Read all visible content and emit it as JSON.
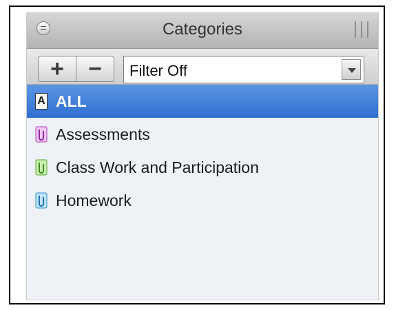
{
  "panel": {
    "title": "Categories"
  },
  "toolbar": {
    "add_label": "+",
    "remove_label": "−",
    "filter_value": "Filter Off"
  },
  "categories": [
    {
      "label": "ALL",
      "icon": "all-icon",
      "selected": true
    },
    {
      "label": "Assessments",
      "icon": "paperclip-icon",
      "color": "#d04cd9"
    },
    {
      "label": "Class Work and Participation",
      "icon": "paperclip-icon",
      "color": "#7ac93a"
    },
    {
      "label": "Homework",
      "icon": "paperclip-icon",
      "color": "#3aa7e5"
    }
  ],
  "colors": {
    "selection": "#2f6fd1",
    "panel_bg": "#eef2f7"
  }
}
